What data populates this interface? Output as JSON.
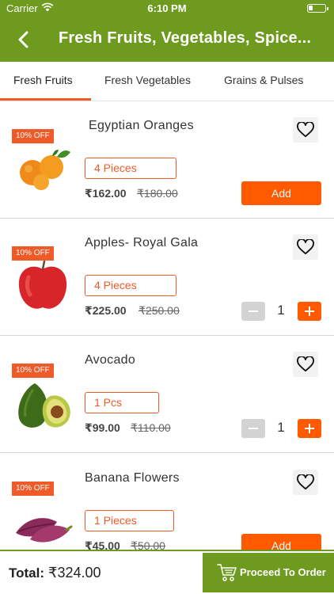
{
  "status_bar": {
    "carrier": "Carrier",
    "time": "6:10 PM"
  },
  "header": {
    "title": "Fresh Fruits, Vegetables, Spice..."
  },
  "tabs": [
    {
      "label": "Fresh Fruits",
      "selected": true
    },
    {
      "label": "Fresh Vegetables",
      "selected": false
    },
    {
      "label": "Grains & Pulses",
      "selected": false
    }
  ],
  "products": [
    {
      "name": "Egyptian Oranges",
      "badge": "10% OFF",
      "quantity_option": "4 Pieces",
      "price": "₹162.00",
      "mrp": "₹180.00",
      "action": "Add",
      "favorite": false
    },
    {
      "name": "Apples- Royal Gala",
      "badge": "10% OFF",
      "quantity_option": "4 Pieces",
      "price": "₹225.00",
      "mrp": "₹250.00",
      "cart_count": "1",
      "favorite": false
    },
    {
      "name": "Avocado",
      "badge": "10% OFF",
      "quantity_option": "1 Pcs",
      "price": "₹99.00",
      "mrp": "₹110.00",
      "cart_count": "1",
      "favorite": false
    },
    {
      "name": "Banana Flowers",
      "badge": "10% OFF",
      "quantity_option": "1 Pieces",
      "price": "₹45.00",
      "mrp": "₹50.00",
      "action": "Add",
      "favorite": false
    }
  ],
  "footer": {
    "total_label": "Total:",
    "total_value": "₹324.00",
    "proceed_label": "Proceed To Order"
  },
  "colors": {
    "primary_green": "#6e9a1f",
    "accent_orange": "#ff5a00",
    "badge_orange": "#f05a28"
  }
}
